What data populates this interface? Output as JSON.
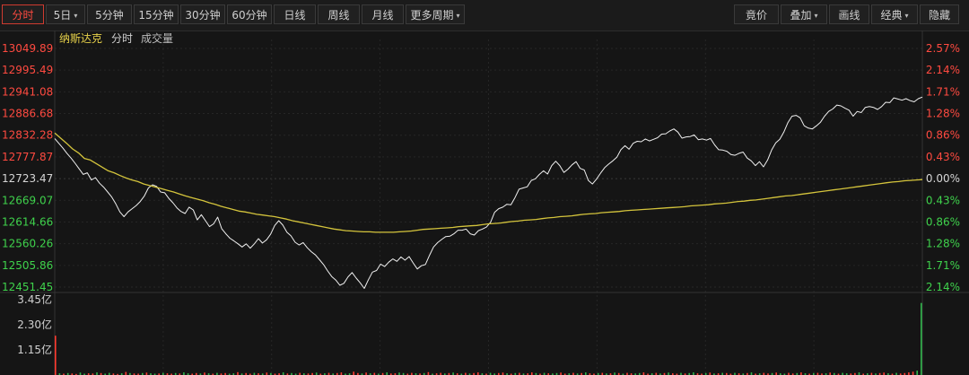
{
  "toolbar": {
    "left_buttons": [
      {
        "label": "分时",
        "active": true,
        "dropdown": false
      },
      {
        "label": "5日",
        "active": false,
        "dropdown": true
      },
      {
        "label": "5分钟",
        "active": false,
        "dropdown": false
      },
      {
        "label": "15分钟",
        "active": false,
        "dropdown": false
      },
      {
        "label": "30分钟",
        "active": false,
        "dropdown": false
      },
      {
        "label": "60分钟",
        "active": false,
        "dropdown": false
      },
      {
        "label": "日线",
        "active": false,
        "dropdown": false
      },
      {
        "label": "周线",
        "active": false,
        "dropdown": false
      },
      {
        "label": "月线",
        "active": false,
        "dropdown": false
      },
      {
        "label": "更多周期",
        "active": false,
        "dropdown": true
      }
    ],
    "right_buttons": [
      {
        "label": "竟价",
        "dropdown": false
      },
      {
        "label": "叠加",
        "dropdown": true
      },
      {
        "label": "画线",
        "dropdown": false
      },
      {
        "label": "经典",
        "dropdown": true
      },
      {
        "label": "隐藏",
        "dropdown": false
      }
    ]
  },
  "legend": {
    "symbol": "纳斯达克",
    "mode": "分时",
    "volume": "成交量"
  },
  "colors": {
    "background": "#151515",
    "price_line": "#f0f0f0",
    "avg_line": "#d4c43c",
    "up_text": "#ff4a40",
    "down_text": "#3fd24c",
    "neutral_text": "#d6d6d6",
    "volume_up": "#ff3b30",
    "volume_down": "#2fb44a"
  },
  "chart_data": {
    "type": "line",
    "price_axis": {
      "labels": [
        "13049.89",
        "12995.49",
        "12941.08",
        "12886.68",
        "12832.28",
        "12777.87",
        "12723.47",
        "12669.07",
        "12614.66",
        "12560.26",
        "12505.86",
        "12451.45"
      ],
      "ylim": [
        12451.45,
        13049.89
      ],
      "reference": 12723.47
    },
    "percent_axis": {
      "labels": [
        "2.57%",
        "2.14%",
        "1.71%",
        "1.28%",
        "0.86%",
        "0.43%",
        "0.00%",
        "0.43%",
        "0.86%",
        "1.28%",
        "1.71%",
        "2.14%"
      ]
    },
    "volume_axis": {
      "labels": [
        "3.45亿",
        "2.30亿",
        "1.15亿"
      ],
      "ylim": [
        0,
        345000000
      ]
    },
    "series": [
      {
        "values": [
          12824,
          12812,
          12800,
          12787,
          12775,
          12762,
          12748,
          12734,
          12738,
          12720,
          12726,
          12712,
          12702,
          12690,
          12677,
          12660,
          12640,
          12628,
          12640,
          12648,
          12656,
          12666,
          12680,
          12700,
          12708,
          12704,
          12690,
          12688,
          12674,
          12663,
          12650,
          12641,
          12636,
          12652,
          12645,
          12620,
          12633,
          12618,
          12603,
          12610,
          12627,
          12598,
          12585,
          12574,
          12567,
          12560,
          12552,
          12560,
          12549,
          12560,
          12573,
          12562,
          12570,
          12584,
          12606,
          12618,
          12607,
          12589,
          12580,
          12564,
          12557,
          12563,
          12550,
          12540,
          12532,
          12520,
          12508,
          12492,
          12478,
          12469,
          12456,
          12461,
          12477,
          12488,
          12474,
          12462,
          12448,
          12470,
          12489,
          12493,
          12509,
          12503,
          12514,
          12522,
          12516,
          12527,
          12519,
          12528,
          12512,
          12497,
          12505,
          12508,
          12531,
          12552,
          12563,
          12571,
          12578,
          12579,
          12585,
          12594,
          12594,
          12597,
          12585,
          12582,
          12593,
          12597,
          12602,
          12614,
          12639,
          12648,
          12652,
          12659,
          12658,
          12676,
          12697,
          12700,
          12703,
          12719,
          12723,
          12734,
          12743,
          12735,
          12756,
          12767,
          12756,
          12739,
          12747,
          12758,
          12766,
          12749,
          12745,
          12719,
          12710,
          12722,
          12737,
          12751,
          12760,
          12768,
          12777,
          12796,
          12806,
          12797,
          12812,
          12817,
          12816,
          12823,
          12818,
          12822,
          12826,
          12835,
          12836,
          12843,
          12848,
          12840,
          12825,
          12828,
          12829,
          12833,
          12821,
          12823,
          12820,
          12824,
          12808,
          12796,
          12795,
          12792,
          12784,
          12782,
          12787,
          12790,
          12775,
          12768,
          12756,
          12766,
          12753,
          12770,
          12795,
          12813,
          12822,
          12840,
          12864,
          12880,
          12882,
          12876,
          12856,
          12850,
          12848,
          12856,
          12865,
          12880,
          12892,
          12898,
          12908,
          12906,
          12900,
          12895,
          12880,
          12892,
          12889,
          12902,
          12904,
          12902,
          12897,
          12904,
          12915,
          12914,
          12926,
          12923,
          12920,
          12924,
          12919,
          12916,
          12924,
          12928
        ]
      },
      {
        "values": [
          12838,
          12825,
          12812,
          12798,
          12788,
          12774,
          12770,
          12761,
          12752,
          12743,
          12738,
          12731,
          12725,
          12720,
          12716,
          12710,
          12706,
          12702,
          12698,
          12694,
          12690,
          12685,
          12680,
          12676,
          12672,
          12668,
          12663,
          12659,
          12654,
          12650,
          12646,
          12642,
          12640,
          12637,
          12634,
          12632,
          12630,
          12628,
          12625,
          12622,
          12618,
          12615,
          12612,
          12609,
          12606,
          12603,
          12600,
          12597,
          12595,
          12593,
          12592,
          12591,
          12590,
          12590,
          12589,
          12589,
          12589,
          12589,
          12590,
          12591,
          12592,
          12594,
          12596,
          12597,
          12598,
          12599,
          12600,
          12601,
          12603,
          12604,
          12605,
          12606,
          12608,
          12610,
          12611,
          12612,
          12614,
          12616,
          12617,
          12619,
          12620,
          12621,
          12623,
          12625,
          12626,
          12628,
          12629,
          12630,
          12632,
          12634,
          12635,
          12636,
          12638,
          12639,
          12640,
          12641,
          12643,
          12644,
          12645,
          12646,
          12647,
          12648,
          12649,
          12650,
          12651,
          12652,
          12653,
          12655,
          12656,
          12657,
          12658,
          12660,
          12661,
          12662,
          12664,
          12666,
          12667,
          12669,
          12670,
          12672,
          12674,
          12676,
          12678,
          12680,
          12681,
          12683,
          12685,
          12687,
          12689,
          12691,
          12693,
          12695,
          12697,
          12699,
          12701,
          12703,
          12705,
          12707,
          12709,
          12711,
          12713,
          12715,
          12716,
          12718,
          12719,
          12720,
          12721
        ]
      }
    ],
    "volume": {
      "values": [
        180000000,
        8000000,
        6000000,
        9000000,
        7000000,
        5000000,
        11000000,
        6000000,
        8000000,
        7000000,
        12000000,
        9000000,
        6000000,
        10000000,
        7000000,
        5000000,
        8000000,
        14000000,
        9000000,
        7000000,
        6000000,
        9000000,
        11000000,
        8000000,
        6000000,
        7000000,
        10000000,
        8000000,
        6000000,
        9000000,
        7000000,
        12000000,
        8000000,
        6000000,
        9000000,
        7000000,
        11000000,
        8000000,
        6000000,
        10000000,
        7000000,
        9000000,
        6000000,
        8000000,
        13000000,
        7000000,
        9000000,
        6000000,
        10000000,
        8000000,
        7000000,
        11000000,
        9000000,
        6000000,
        8000000,
        12000000,
        7000000,
        9000000,
        6000000,
        10000000,
        8000000,
        7000000,
        9000000,
        11000000,
        6000000,
        8000000,
        10000000,
        7000000,
        9000000,
        12000000,
        6000000,
        8000000,
        15000000,
        9000000,
        7000000,
        11000000,
        8000000,
        10000000,
        6000000,
        9000000,
        12000000,
        7000000,
        8000000,
        11000000,
        9000000,
        6000000,
        10000000,
        8000000,
        7000000,
        9000000,
        13000000,
        6000000,
        8000000,
        10000000,
        7000000,
        9000000,
        11000000,
        8000000,
        6000000,
        10000000,
        7000000,
        9000000,
        12000000,
        8000000,
        6000000,
        10000000,
        7000000,
        9000000,
        11000000,
        8000000,
        6000000,
        9000000,
        10000000,
        7000000,
        8000000,
        12000000,
        9000000,
        6000000,
        10000000,
        8000000,
        7000000,
        9000000,
        11000000,
        6000000,
        8000000,
        10000000,
        7000000,
        9000000,
        12000000,
        8000000,
        6000000,
        9000000,
        10000000,
        7000000,
        8000000,
        11000000,
        9000000,
        6000000,
        10000000,
        8000000,
        7000000,
        9000000,
        12000000,
        6000000,
        8000000,
        10000000,
        7000000,
        9000000,
        11000000,
        8000000,
        6000000,
        10000000,
        7000000,
        9000000,
        12000000,
        8000000,
        6000000,
        9000000,
        11000000,
        7000000,
        8000000,
        10000000,
        9000000,
        6000000,
        10000000,
        8000000,
        7000000,
        9000000,
        12000000,
        6000000,
        8000000,
        10000000,
        7000000,
        9000000,
        11000000,
        8000000,
        6000000,
        10000000,
        7000000,
        9000000,
        12000000,
        8000000,
        6000000,
        9000000,
        10000000,
        7000000,
        8000000,
        11000000,
        9000000,
        6000000,
        10000000,
        8000000,
        7000000,
        9000000,
        12000000,
        6000000,
        8000000,
        10000000,
        7000000,
        9000000,
        11000000,
        8000000,
        6000000,
        10000000,
        7000000,
        9000000,
        12000000,
        15000000,
        20000000,
        330000000
      ],
      "up": [
        true,
        false,
        true,
        false,
        true,
        true,
        false,
        false,
        true,
        true,
        false,
        true,
        false,
        false,
        true,
        true,
        false,
        true,
        false,
        true,
        true,
        false,
        true,
        false,
        false,
        true,
        false,
        true,
        true,
        false,
        true,
        false,
        false,
        true,
        true,
        false,
        true,
        false,
        true,
        false,
        true,
        true,
        false,
        false,
        true,
        false,
        true,
        true,
        false,
        true,
        false,
        true,
        false,
        true,
        true,
        false,
        true,
        false,
        false,
        true,
        false,
        true,
        true,
        false,
        true,
        false,
        true,
        false,
        true,
        true,
        false,
        false,
        true,
        true,
        false,
        true,
        false,
        true,
        false,
        true,
        false,
        true,
        true,
        false,
        false,
        true,
        true,
        false,
        true,
        false,
        true,
        false,
        true,
        true,
        false,
        true,
        false,
        true,
        false,
        true,
        false,
        true,
        true,
        false,
        true,
        false,
        false,
        true,
        true,
        false,
        true,
        false,
        true,
        false,
        true,
        true,
        false,
        true,
        false,
        true,
        false,
        false,
        true,
        true,
        false,
        true,
        false,
        true,
        false,
        true,
        true,
        false,
        true,
        false,
        true,
        false,
        true,
        false,
        true,
        true,
        false,
        false,
        true,
        true,
        false,
        true,
        false,
        true,
        false,
        true,
        true,
        false,
        true,
        false,
        false,
        true,
        true,
        false,
        true,
        false,
        true,
        false,
        true,
        true,
        false,
        true,
        false,
        true,
        false,
        true,
        false,
        true,
        true,
        false,
        true,
        false,
        false,
        true,
        true,
        false,
        true,
        false,
        true,
        false,
        true,
        true,
        false,
        true,
        false,
        true,
        false,
        false,
        true,
        true,
        false,
        true,
        false,
        true,
        false,
        true,
        true,
        false,
        true,
        false,
        true,
        true,
        true,
        true
      ]
    },
    "grid": true
  }
}
